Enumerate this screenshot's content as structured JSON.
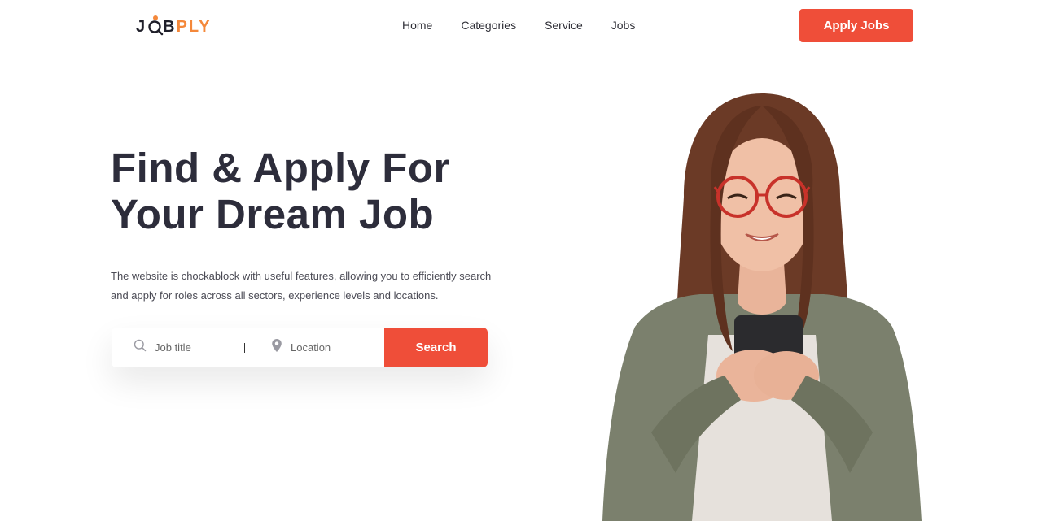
{
  "header": {
    "logo": {
      "part1": "J",
      "part2": "B",
      "part3": "PLY"
    },
    "nav": [
      {
        "label": "Home"
      },
      {
        "label": "Categories"
      },
      {
        "label": "Service"
      },
      {
        "label": "Jobs"
      }
    ],
    "apply_label": "Apply Jobs"
  },
  "hero": {
    "title_line1": "Find & Apply For",
    "title_line2": "Your Dream Job",
    "description": "The website is chockablock with useful features, allowing you to efficiently search and apply for roles across all sectors, experience levels and locations."
  },
  "search": {
    "job_placeholder": "Job title",
    "location_placeholder": "Location",
    "button_label": "Search",
    "job_icon": "search-icon",
    "location_icon": "location-pin-icon"
  },
  "colors": {
    "accent": "#ef4e39",
    "logo_orange": "#f4883a",
    "heading": "#2d2d3b"
  }
}
